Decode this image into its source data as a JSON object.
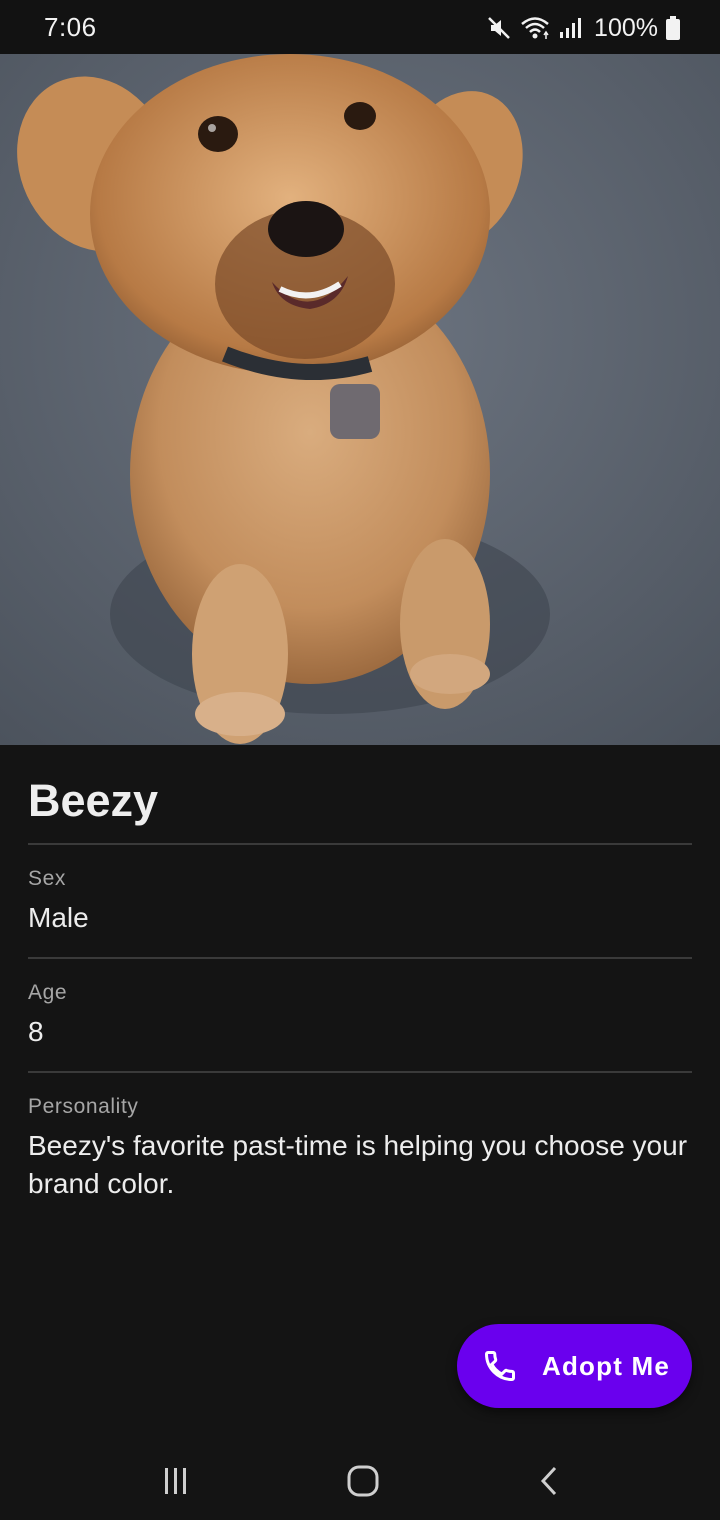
{
  "status_bar": {
    "time": "7:06",
    "battery": "100%",
    "icons": [
      "mute-icon",
      "wifi-icon",
      "signal-icon",
      "battery-icon"
    ]
  },
  "pet": {
    "name": "Beezy",
    "photo_icon": "dog-photo"
  },
  "fields": [
    {
      "label": "Sex",
      "value": "Male"
    },
    {
      "label": "Age",
      "value": "8"
    },
    {
      "label": "Personality",
      "value": "Beezy's favorite past-time is helping you choose your brand color."
    }
  ],
  "fab": {
    "label": "Adopt Me",
    "icon": "phone-icon",
    "color": "#6a00ee"
  },
  "nav": {
    "icons": [
      "recent-apps-icon",
      "home-icon",
      "back-icon"
    ]
  }
}
